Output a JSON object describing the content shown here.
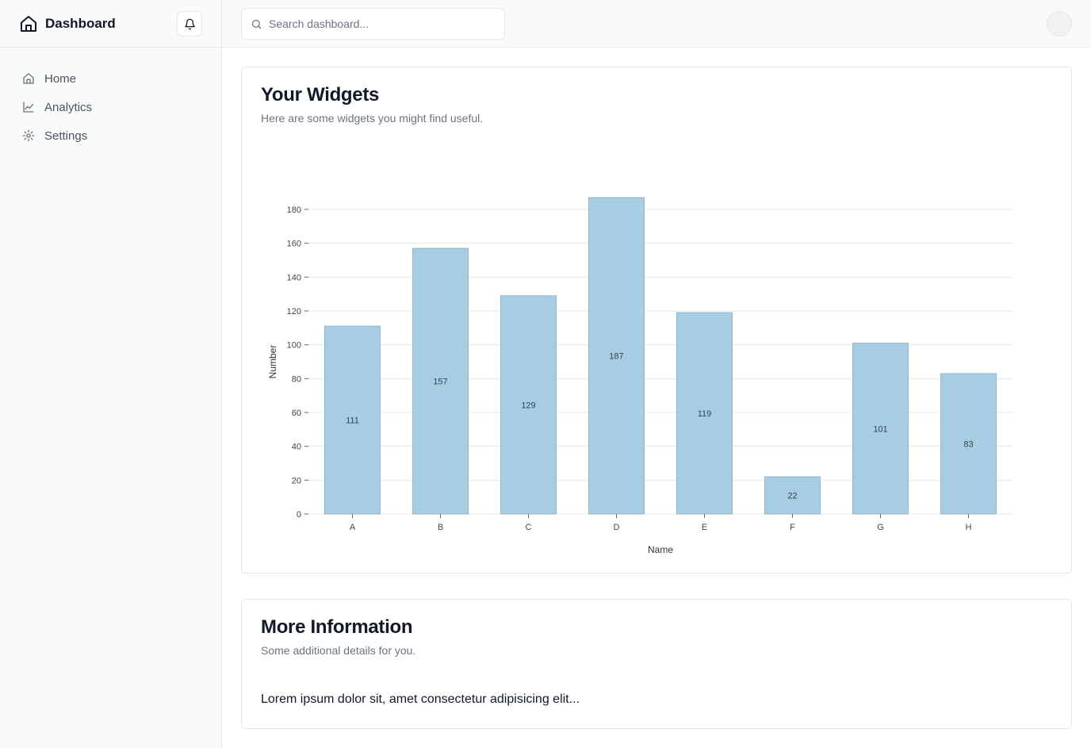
{
  "sidebar": {
    "brand": "Dashboard",
    "items": [
      {
        "label": "Home",
        "icon": "home-icon"
      },
      {
        "label": "Analytics",
        "icon": "line-chart-icon"
      },
      {
        "label": "Settings",
        "icon": "gear-icon"
      }
    ]
  },
  "header": {
    "search_placeholder": "Search dashboard..."
  },
  "widgets_card": {
    "title": "Your Widgets",
    "description": "Here are some widgets you might find useful."
  },
  "info_card": {
    "title": "More Information",
    "description": "Some additional details for you.",
    "body": "Lorem ipsum dolor sit, amet consectetur adipisicing elit..."
  },
  "colors": {
    "bar_fill": "#a6cde2",
    "bar_stroke": "#8fb8ce",
    "grid": "#e5e7eb",
    "muted_text": "#6b7280"
  },
  "chart_data": {
    "type": "bar",
    "categories": [
      "A",
      "B",
      "C",
      "D",
      "E",
      "F",
      "G",
      "H"
    ],
    "values": [
      111,
      157,
      129,
      187,
      119,
      22,
      101,
      83
    ],
    "xlabel": "Name",
    "ylabel": "Number",
    "ylim": [
      0,
      180
    ],
    "yticks": [
      0,
      20,
      40,
      60,
      80,
      100,
      120,
      140,
      160,
      180
    ],
    "grid": true,
    "data_labels": true
  }
}
